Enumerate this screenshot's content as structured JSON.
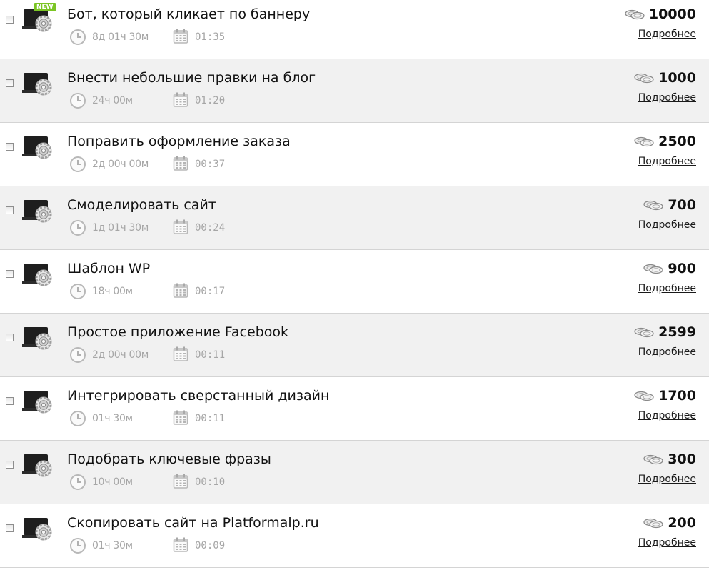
{
  "colors": {
    "badge_green": "#7bc524",
    "alt_row_bg": "#f1f1f1",
    "meta_gray": "#a6a6a6"
  },
  "badge_label": "NEW",
  "details_label": "Подробнее",
  "icons": {
    "thumbnail": "computer-gear-icon",
    "clock": "clock-icon",
    "calendar": "calendar-icon",
    "price": "coins-icon"
  },
  "tasks": [
    {
      "title": "Бот, который кликает по баннеру",
      "time_left": "8д 01ч 30м",
      "duration": "01:35",
      "price": "10000",
      "is_new": true
    },
    {
      "title": "Внести небольшие правки на блог",
      "time_left": "24ч 00м",
      "duration": "01:20",
      "price": "1000",
      "is_new": false
    },
    {
      "title": "Поправить оформление заказа",
      "time_left": "2д 00ч 00м",
      "duration": "00:37",
      "price": "2500",
      "is_new": false
    },
    {
      "title": "Смоделировать сайт",
      "time_left": "1д 01ч 30м",
      "duration": "00:24",
      "price": "700",
      "is_new": false
    },
    {
      "title": "Шаблон WP",
      "time_left": "18ч 00м",
      "duration": "00:17",
      "price": "900",
      "is_new": false
    },
    {
      "title": "Простое приложение Facebook",
      "time_left": "2д 00ч 00м",
      "duration": "00:11",
      "price": "2599",
      "is_new": false
    },
    {
      "title": "Интегрировать сверстанный дизайн",
      "time_left": "01ч 30м",
      "duration": "00:11",
      "price": "1700",
      "is_new": false
    },
    {
      "title": "Подобрать ключевые фразы",
      "time_left": "10ч 00м",
      "duration": "00:10",
      "price": "300",
      "is_new": false
    },
    {
      "title": "Скопировать сайт на Platformalp.ru",
      "time_left": "01ч 30м",
      "duration": "00:09",
      "price": "200",
      "is_new": false
    }
  ]
}
